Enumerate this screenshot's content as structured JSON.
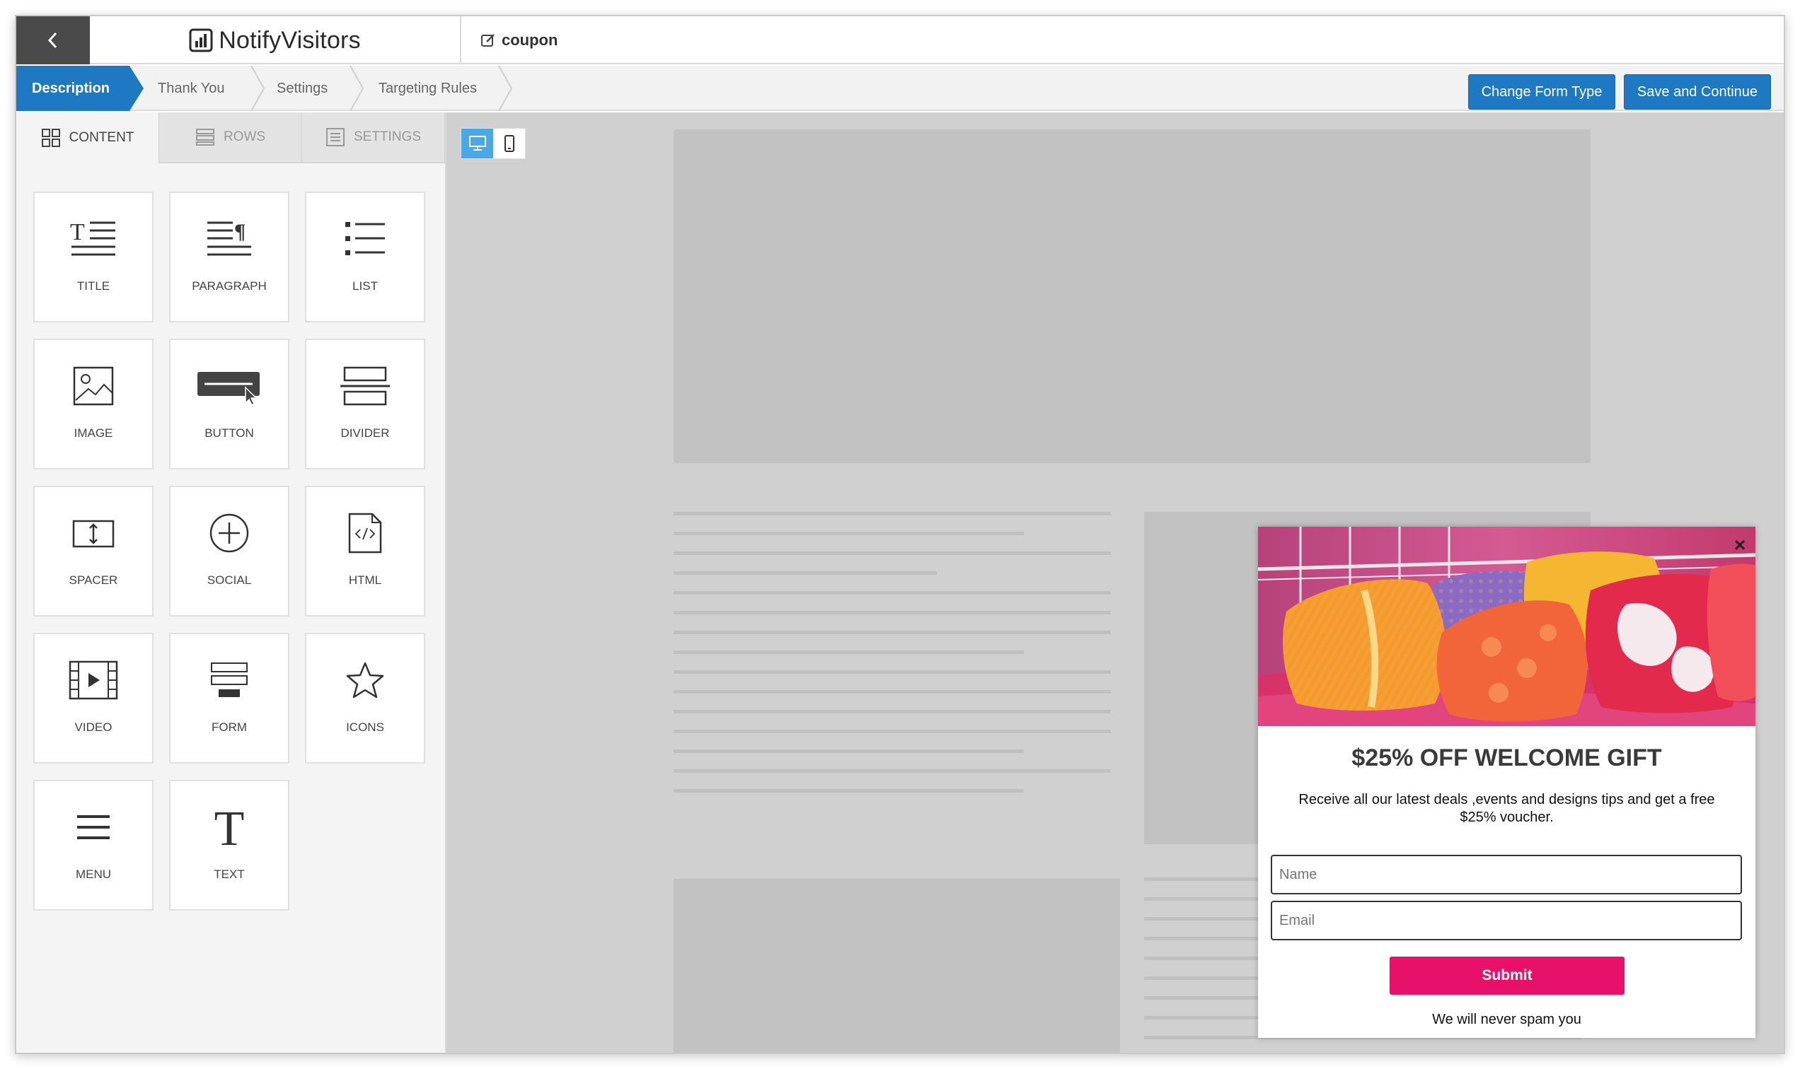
{
  "header": {
    "logo_text": "NotifyVisitors",
    "form_name": "coupon"
  },
  "steps": [
    {
      "label": "Description",
      "active": true
    },
    {
      "label": "Thank You",
      "active": false
    },
    {
      "label": "Settings",
      "active": false
    },
    {
      "label": "Targeting Rules",
      "active": false
    }
  ],
  "actions": {
    "change_form_type": "Change Form Type",
    "save_continue": "Save and Continue"
  },
  "panel": {
    "tabs": [
      {
        "label": "CONTENT",
        "icon": "grid-icon",
        "active": true
      },
      {
        "label": "ROWS",
        "icon": "rows-icon",
        "active": false
      },
      {
        "label": "SETTINGS",
        "icon": "settings-list-icon",
        "active": false
      }
    ],
    "blocks": [
      {
        "label": "TITLE",
        "icon": "title-icon"
      },
      {
        "label": "PARAGRAPH",
        "icon": "paragraph-icon"
      },
      {
        "label": "LIST",
        "icon": "list-icon"
      },
      {
        "label": "IMAGE",
        "icon": "image-icon"
      },
      {
        "label": "BUTTON",
        "icon": "button-icon"
      },
      {
        "label": "DIVIDER",
        "icon": "divider-icon"
      },
      {
        "label": "SPACER",
        "icon": "spacer-icon"
      },
      {
        "label": "SOCIAL",
        "icon": "social-icon"
      },
      {
        "label": "HTML",
        "icon": "html-icon"
      },
      {
        "label": "VIDEO",
        "icon": "video-icon"
      },
      {
        "label": "FORM",
        "icon": "form-icon"
      },
      {
        "label": "ICONS",
        "icon": "star-icon"
      },
      {
        "label": "MENU",
        "icon": "menu-icon"
      },
      {
        "label": "TEXT",
        "icon": "text-icon"
      }
    ]
  },
  "device_toggle": {
    "desktop": "desktop-icon",
    "mobile": "mobile-icon",
    "active": "desktop"
  },
  "popup": {
    "title": "$25% OFF WELCOME GIFT",
    "description": "Receive all our latest deals ,events and designs tips and get a free $25% voucher.",
    "name_placeholder": "Name",
    "email_placeholder": "Email",
    "submit_label": "Submit",
    "footer_note": "We will never spam you",
    "close_symbol": "×"
  },
  "colors": {
    "accent_blue": "#1f79c2",
    "submit_pink": "#e8116a",
    "back_button_bg": "#4a4a4a"
  }
}
